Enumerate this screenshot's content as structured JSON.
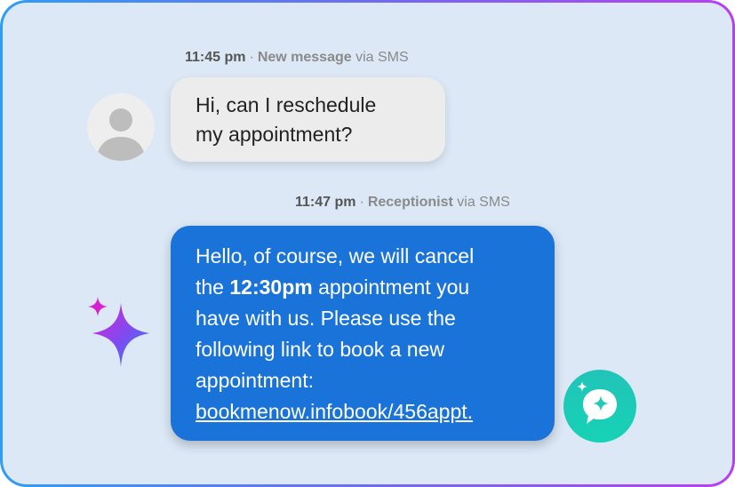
{
  "messages": [
    {
      "time": "11:45 pm",
      "sender": "New message",
      "channel": "via SMS",
      "line1": "Hi, can I reschedule",
      "line2": "my appointment?"
    },
    {
      "time": "11:47 pm",
      "sender": "Receptionist",
      "channel": "via SMS",
      "text_a": "Hello, of course, we will cancel",
      "text_b": "the ",
      "bold_time": "12:30pm",
      "text_c": " appointment you",
      "text_d": "have with us. Please use the",
      "text_e": "following link to book a new",
      "text_f": "appointment:",
      "link": "bookmenow.infobook/456appt."
    }
  ],
  "icons": {
    "avatar": "user-avatar-icon",
    "sparkle": "ai-sparkle-icon",
    "chat": "ai-chat-badge-icon"
  },
  "colors": {
    "frame_gradient_start": "#2f9df4",
    "frame_gradient_end": "#b83ff0",
    "background": "#dce8f6",
    "incoming_bubble": "#ececec",
    "outgoing_bubble": "#1a73d9",
    "badge": "#1ecbb7"
  }
}
